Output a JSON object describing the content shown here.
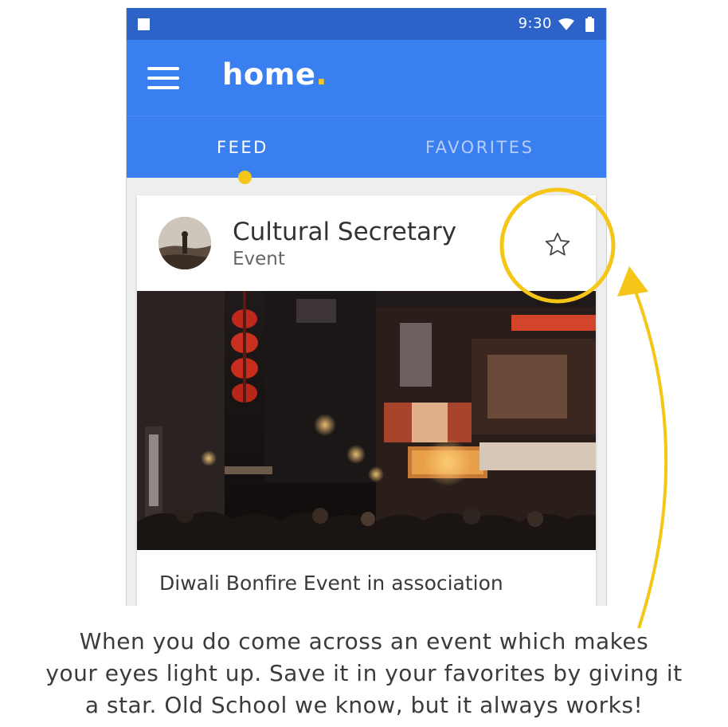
{
  "status_bar": {
    "time": "9:30"
  },
  "app_bar": {
    "title": "home",
    "title_dot": ".",
    "accent_color": "#f5c518",
    "brand_color": "#3a7ff0"
  },
  "tabs": [
    {
      "label": "FEED",
      "active": true
    },
    {
      "label": "FAVORITES",
      "active": false
    }
  ],
  "card": {
    "title": "Cultural Secretary",
    "subtitle": "Event",
    "description": "Diwali Bonfire Event in association",
    "star_icon": "star-outline-icon"
  },
  "caption": {
    "lines": [
      "When you do come across an event which makes",
      "your eyes light up. Save it in your favorites by giving it",
      "a star. Old School we know, but it always works!"
    ]
  }
}
